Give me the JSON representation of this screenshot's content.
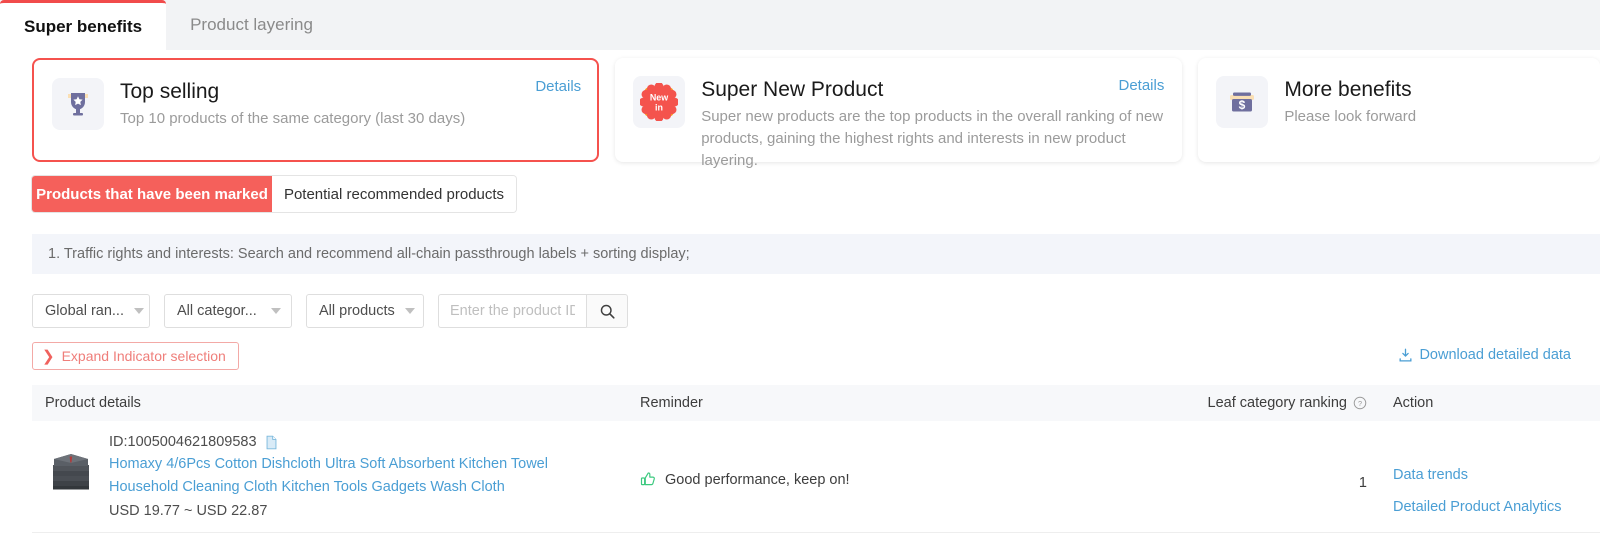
{
  "tabs": [
    {
      "label": "Super benefits",
      "active": true
    },
    {
      "label": "Product layering",
      "active": false
    }
  ],
  "cards": [
    {
      "icon": "trophy-star-icon",
      "title": "Top selling",
      "desc": "Top 10 products of the same category (last 30 days)",
      "details_label": "Details",
      "highlighted": true
    },
    {
      "icon": "new-in-badge-icon",
      "title": "Super New Product",
      "desc": "Super new products are the top products in the overall ranking of new products, gaining the highest rights and interests in new product layering.",
      "details_label": "Details",
      "highlighted": false
    },
    {
      "icon": "money-box-dollar-icon",
      "title": "More benefits",
      "desc": "Please look forward",
      "details_label": "",
      "highlighted": false
    }
  ],
  "segmented": {
    "options": [
      {
        "label": "Products that have been marked",
        "active": true
      },
      {
        "label": "Potential recommended products",
        "active": false
      }
    ]
  },
  "banner": {
    "text": "1. Traffic rights and interests: Search and recommend all-chain passthrough labels + sorting display;"
  },
  "filters": {
    "ranking_scope": "Global ran...",
    "category": "All categor...",
    "product_set": "All products",
    "search_placeholder": "Enter the product ID",
    "search_value": "",
    "search_icon": "search-icon"
  },
  "expand_indicator": {
    "label": "Expand Indicator selection",
    "icon": "chevron-right-icon"
  },
  "download": {
    "label": "Download detailed data",
    "icon": "download-icon"
  },
  "table": {
    "columns": [
      "Product details",
      "Reminder",
      "Leaf category ranking",
      "Action"
    ],
    "rank_help_icon": "question-circle-icon",
    "rows": [
      {
        "thumbnail": "stacked-gray-dishcloths-image",
        "id_label": "ID:1005004621809583",
        "copy_icon": "copy-icon",
        "title": "Homaxy 4/6Pcs Cotton Dishcloth Ultra Soft Absorbent Kitchen Towel Household Cleaning Cloth Kitchen Tools Gadgets Wash Cloth",
        "price": "USD 19.77 ~ USD 22.87",
        "reminder_icon": "thumbs-up-icon",
        "reminder": "Good performance, keep on!",
        "leaf_category_ranking": "1",
        "actions": [
          "Data trends",
          "Detailed Product Analytics"
        ]
      }
    ]
  },
  "colors": {
    "accent_red": "#f5524e",
    "segment_active": "#f5605b",
    "link_blue": "#4a9ed4",
    "banner_bg": "#f3f5fa",
    "tabbar_bg": "#f2f3f5",
    "reminder_green": "#3cc97f",
    "icon_purple": "#6f6f9e"
  }
}
